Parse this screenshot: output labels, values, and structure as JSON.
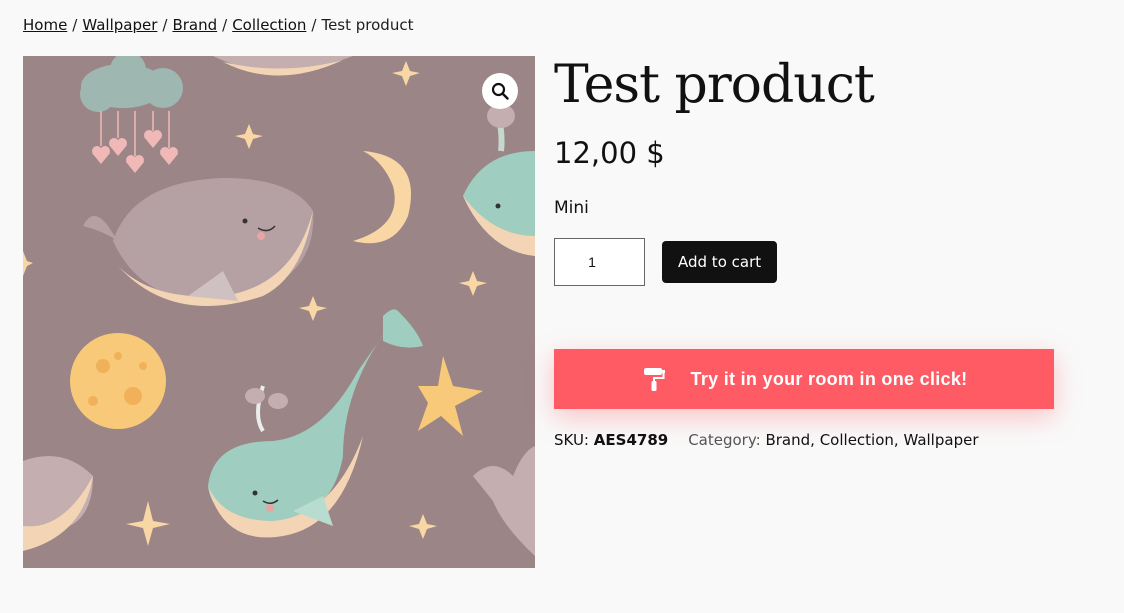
{
  "breadcrumb": {
    "items": [
      "Home",
      "Wallpaper",
      "Brand",
      "Collection"
    ],
    "current": "Test product",
    "separator": "/"
  },
  "gallery": {
    "zoom_icon": "magnifier-icon",
    "background_color": "#9b8587"
  },
  "product": {
    "title": "Test product",
    "price": "12,00 $",
    "variation": "Mini",
    "quantity": "1"
  },
  "buttons": {
    "add_to_cart": "Add to cart",
    "try_in_room": "Try it in your room in one click!",
    "try_icon": "paint-roller-icon"
  },
  "meta": {
    "sku_label": "SKU:",
    "sku_value": "AES4789",
    "category_label": "Category:",
    "categories": [
      "Brand",
      "Collection",
      "Wallpaper"
    ]
  },
  "colors": {
    "accent": "#ff5b65",
    "button_dark": "#111111"
  }
}
